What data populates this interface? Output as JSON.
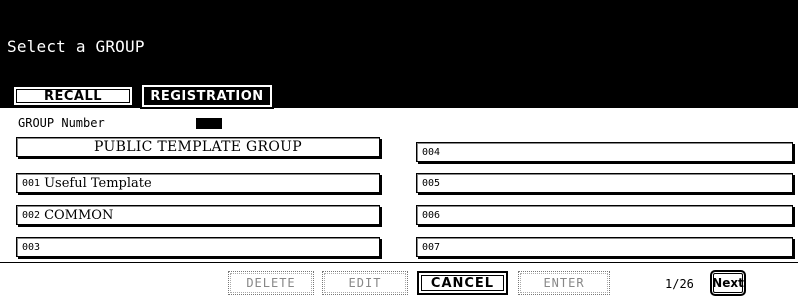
{
  "header": {
    "title": "Select a GROUP"
  },
  "tabs": {
    "recall": "RECALL",
    "registration": "REGISTRATION"
  },
  "group_number_label": "GROUP Number",
  "groups": [
    {
      "num": "",
      "name": "PUBLIC TEMPLATE GROUP"
    },
    {
      "num": "001",
      "name": "Useful Template"
    },
    {
      "num": "002",
      "name": "COMMON"
    },
    {
      "num": "003",
      "name": ""
    },
    {
      "num": "004",
      "name": ""
    },
    {
      "num": "005",
      "name": ""
    },
    {
      "num": "006",
      "name": ""
    },
    {
      "num": "007",
      "name": ""
    }
  ],
  "footer": {
    "delete": "DELETE",
    "edit": "EDIT",
    "cancel": "CANCEL",
    "enter": "ENTER",
    "page": "1/26",
    "next": "Next"
  }
}
